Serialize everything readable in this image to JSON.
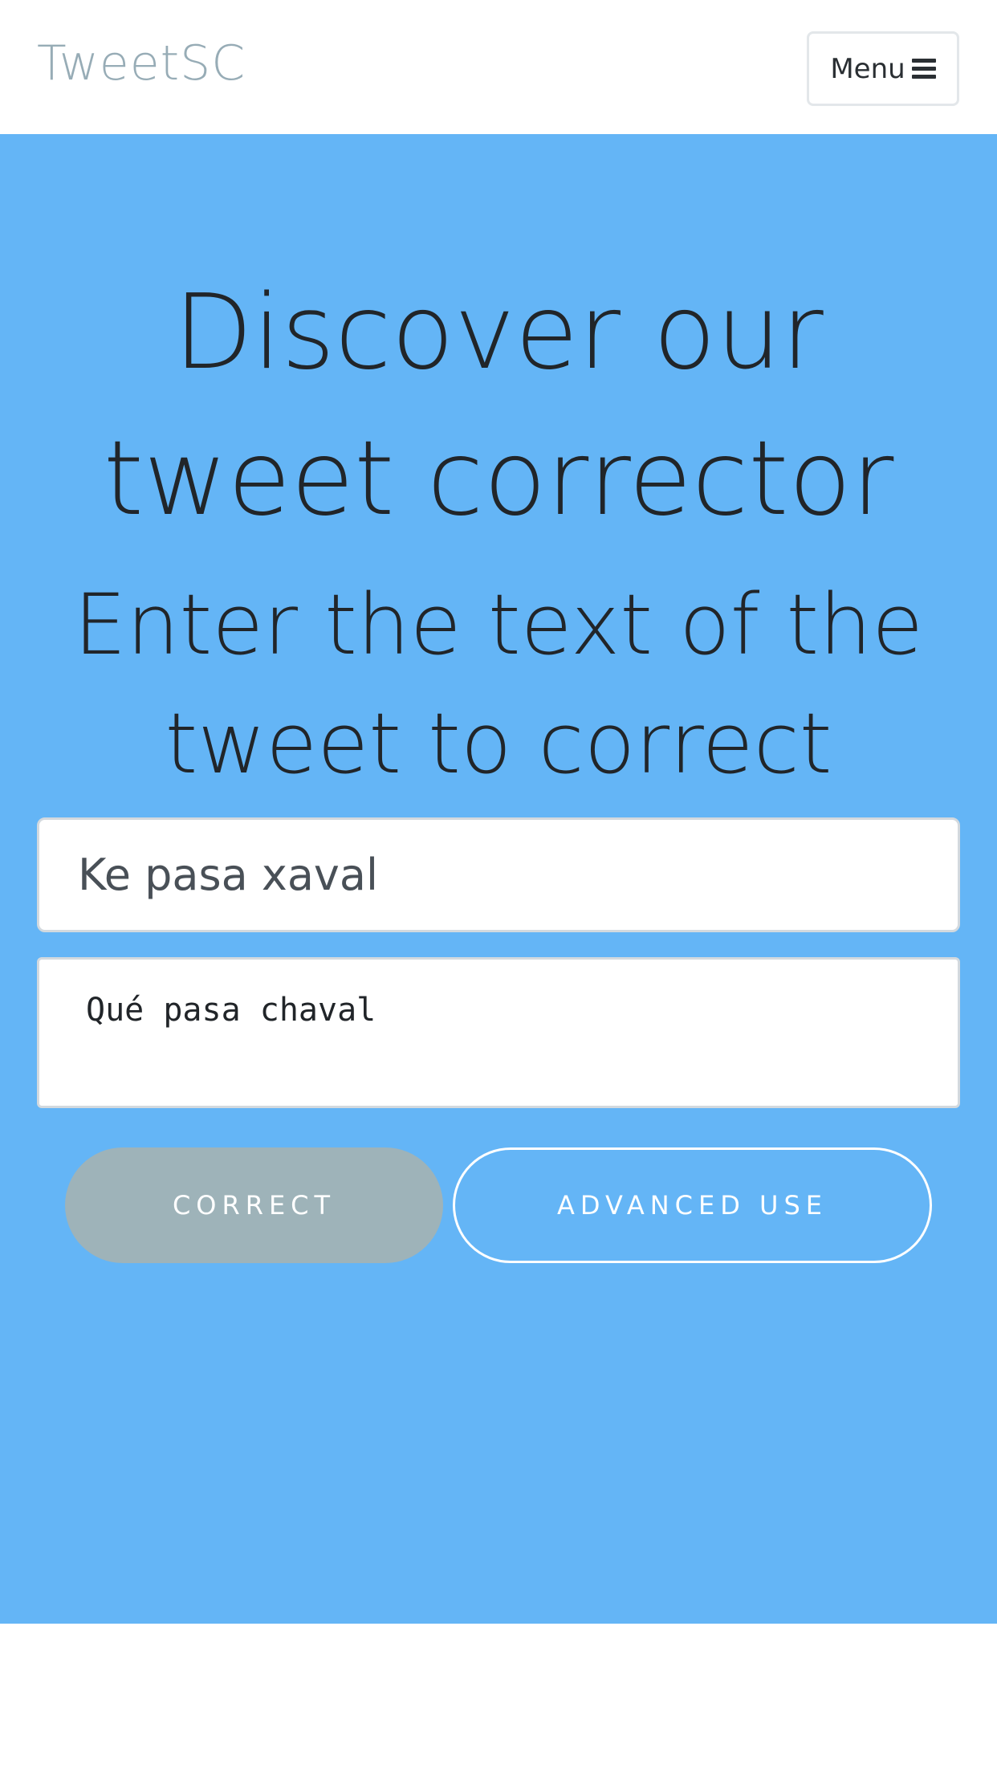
{
  "navbar": {
    "brand": "TweetSC",
    "menu_label": "Menu",
    "menu_icon": "bars-icon"
  },
  "hero": {
    "title": "Discover our\ntweet corrector",
    "subtitle": "Enter the text of the\ntweet to correct",
    "background_color": "#64b5f6"
  },
  "form": {
    "input_value": "Ke pasa xaval",
    "output_value": "Qué pasa chaval",
    "correct_label": "CORRECT",
    "advanced_label": "ADVANCED USE"
  }
}
